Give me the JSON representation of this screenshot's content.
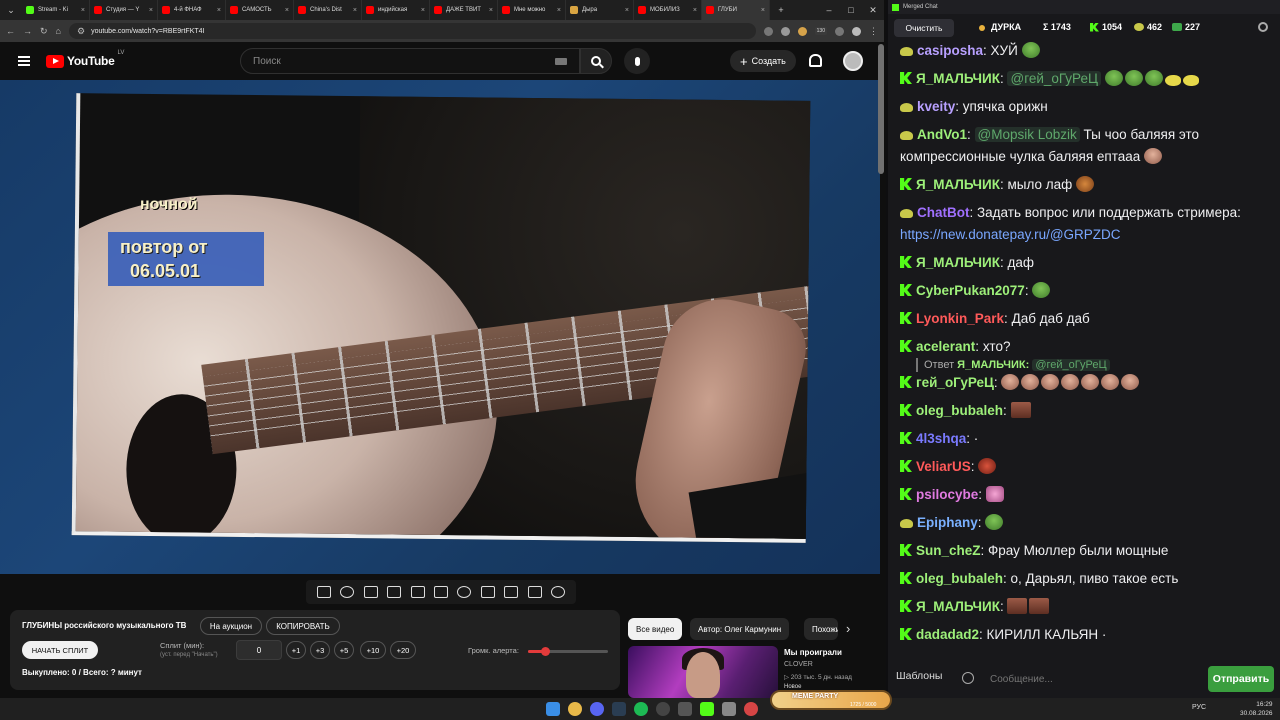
{
  "browser": {
    "tabs": [
      {
        "label": "Stream - Ki",
        "color": "#53fc18"
      },
      {
        "label": "Студия — Y",
        "color": "#ff0000"
      },
      {
        "label": "4-й ФНАФ",
        "color": "#ff0000"
      },
      {
        "label": "САМОСТЬ",
        "color": "#ff0000"
      },
      {
        "label": "China's Dist",
        "color": "#ff0000"
      },
      {
        "label": "индийская",
        "color": "#ff0000"
      },
      {
        "label": "ДАЖЕ ТВИТ",
        "color": "#ff0000"
      },
      {
        "label": "Мне можно",
        "color": "#ff0000"
      },
      {
        "label": "Дыра",
        "color": "#d9a441"
      },
      {
        "label": "МОБИЛИЗ",
        "color": "#ff0000"
      },
      {
        "label": "ГЛУБИ",
        "color": "#ff0000"
      }
    ],
    "url": "youtube.com/watch?v=RBE9rtFKT4I",
    "ext_badge": "130"
  },
  "youtube": {
    "logo": "YouTube",
    "region": "LV",
    "search_placeholder": "Поиск",
    "create_label": "Создать"
  },
  "video": {
    "overlay_top": "ночной",
    "overlay_l1": "повтор от",
    "overlay_l2": "06.05.01"
  },
  "panel": {
    "title": "ГЛУБИНЫ российского музыкального ТВ",
    "auction": "На аукцион",
    "copy": "КОПИРОВАТЬ",
    "start_split": "НАЧАТЬ СПЛИТ",
    "split_label": "Сплит (мин):",
    "split_hint": "(уст. перед \"Начать\")",
    "split_value": "0",
    "steps": [
      "+1",
      "+3",
      "+5",
      "+10",
      "+20"
    ],
    "bought": "Выкуплено: 0 / Всего: ? минут",
    "volume_label": "Громк. алерта:",
    "volume": 0.22,
    "volume_color": "#e33b3b"
  },
  "recs": {
    "chips": [
      "Все видео",
      "Автор: Олег Кармунин",
      "Похожие"
    ],
    "title": "Мы проиграли",
    "channel": "CLOVER",
    "meta": "▷ 203 тыс.   5 дн. назад",
    "badge": "Новое"
  },
  "chat": {
    "window_title": "Merged Chat",
    "clear": "Очистить",
    "stream": "ДУРКА",
    "total": "Σ 1743",
    "kick": "1054",
    "twitch": "462",
    "other": "227",
    "template_btn": "Шаблоны",
    "input_placeholder": "Сообщение...",
    "send": "Отправить",
    "reply_prefix": "Ответ",
    "reply_nick": "Я_МАЛЬЧИК:",
    "reply_mention": "@гей_оГуРеЦ",
    "messages": [
      {
        "p": "t",
        "nick": "casiposha",
        "color": "#b8a0ff",
        "text": "ХУЙ",
        "emotes": [
          "pepe"
        ]
      },
      {
        "p": "k",
        "nick": "Я_МАЛЬЧИК",
        "color": "#9ef07a",
        "mention": "@гей_оГуРеЦ",
        "text": "",
        "emotes": [
          "pepe",
          "pepe",
          "pepe",
          "duck",
          "duck"
        ]
      },
      {
        "p": "t",
        "nick": "kveity",
        "color": "#b8a0ff",
        "text": "упячка орижн",
        "emotes": []
      },
      {
        "p": "t",
        "nick": "AndVo1",
        "color": "#9ef07a",
        "mention": "@Mopsik Lobzik",
        "text": "Ты чоо баляяя это компрессионные чулка баляяя ептааа",
        "emotes": [
          "face"
        ]
      },
      {
        "p": "k",
        "nick": "Я_МАЛЬЧИК",
        "color": "#9ef07a",
        "text": "мыло лаф",
        "emotes": [
          "fox"
        ]
      },
      {
        "p": "t",
        "nick": "ChatBot",
        "color": "#a070ff",
        "text": "Задать вопрос или поддержать стримера:",
        "link": "https://new.donatepay.ru/@GRPZDC",
        "emotes": []
      },
      {
        "p": "k",
        "nick": "Я_МАЛЬЧИК",
        "color": "#9ef07a",
        "text": "даф",
        "emotes": []
      },
      {
        "p": "k",
        "nick": "CyberPukan2077",
        "color": "#9ef07a",
        "text": "",
        "emotes": [
          "pepe"
        ]
      },
      {
        "p": "k",
        "nick": "Lyonkin_Park",
        "color": "#ff5a5a",
        "text": "Даб даб даб",
        "emotes": []
      },
      {
        "p": "k",
        "nick": "acelerant",
        "color": "#9ef07a",
        "text": "хто?",
        "emotes": []
      },
      {
        "p": "k",
        "nick": "гей_оГуРеЦ",
        "color": "#9ef07a",
        "text": "",
        "emotes": [
          "face",
          "face",
          "face",
          "face",
          "face",
          "face",
          "face"
        ]
      },
      {
        "p": "k",
        "nick": "oleg_bubaleh",
        "color": "#9ef07a",
        "text": "",
        "emotes": [
          "brown"
        ]
      },
      {
        "p": "k",
        "nick": "4l3shqa",
        "color": "#7a7aff",
        "text": "·",
        "emotes": []
      },
      {
        "p": "k",
        "nick": "VeliarUS",
        "color": "#ff5a5a",
        "text": "",
        "emotes": [
          "red"
        ]
      },
      {
        "p": "k",
        "nick": "psilocybe",
        "color": "#e07ae0",
        "text": "",
        "emotes": [
          "pink"
        ]
      },
      {
        "p": "t",
        "nick": "Epiphany",
        "color": "#7ab0ff",
        "text": "",
        "emotes": [
          "pepe"
        ]
      },
      {
        "p": "k",
        "nick": "Sun_cheZ",
        "color": "#9ef07a",
        "text": "Фрау Мюллер были мощные",
        "emotes": []
      },
      {
        "p": "k",
        "nick": "oleg_bubaleh",
        "color": "#9ef07a",
        "text": "о, Дарьял, пиво такое есть",
        "emotes": []
      },
      {
        "p": "k",
        "nick": "Я_МАЛЬЧИК",
        "color": "#9ef07a",
        "text": "",
        "emotes": [
          "brown",
          "brown"
        ]
      },
      {
        "p": "k",
        "nick": "dadadad2",
        "color": "#9ef07a",
        "text": "КИРИЛЛ КАЛЬЯН ·",
        "emotes": []
      }
    ]
  },
  "taskbar": {
    "lang": "РУС",
    "time": "16:29",
    "date": "30.08.2026",
    "meme_label": "MEME PARTY",
    "meme_value": "1725 / 5000"
  }
}
